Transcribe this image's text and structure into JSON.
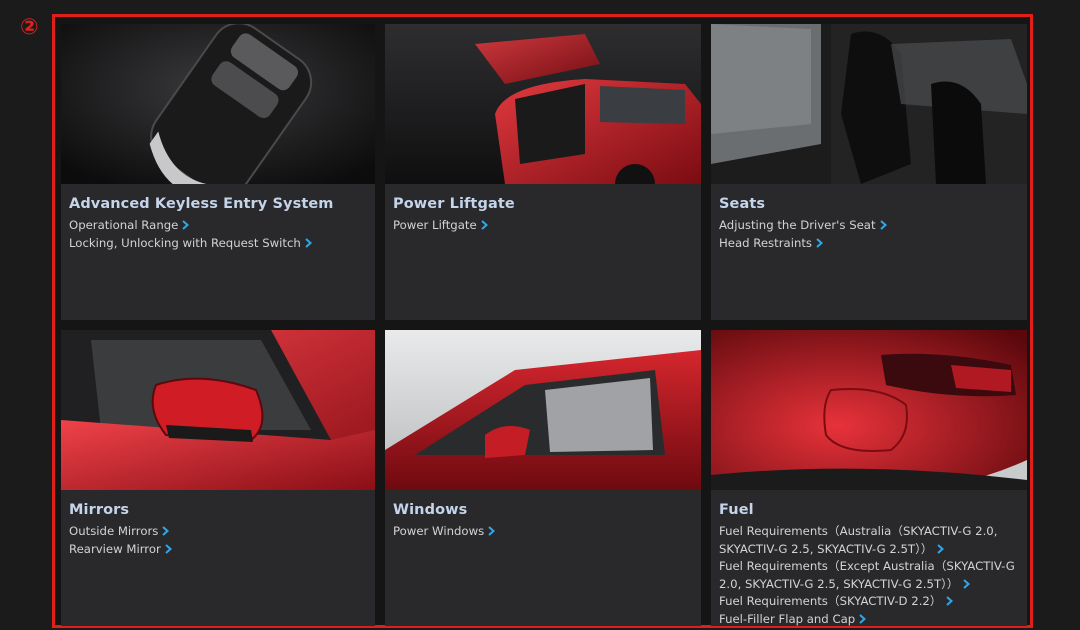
{
  "annotation": {
    "marker": "②"
  },
  "colors": {
    "frame": "#e01f1b",
    "title": "#c4d4ea",
    "link_chevron": "#2ea8ea"
  },
  "cards": [
    {
      "title": "Advanced Keyless Entry System",
      "image": "smart-key-photo",
      "links": [
        "Operational Range",
        "Locking, Unlocking with Request Switch"
      ]
    },
    {
      "title": "Power Liftgate",
      "image": "liftgate-photo",
      "links": [
        "Power Liftgate"
      ]
    },
    {
      "title": "Seats",
      "image": "seats-photo",
      "links": [
        "Adjusting the Driver's Seat",
        "Head Restraints"
      ]
    },
    {
      "title": "Mirrors",
      "image": "mirror-photo",
      "links": [
        "Outside Mirrors",
        "Rearview Mirror"
      ]
    },
    {
      "title": "Windows",
      "image": "windows-photo",
      "links": [
        "Power Windows"
      ]
    },
    {
      "title": "Fuel",
      "image": "fuel-photo",
      "links": [
        "Fuel Requirements（Australia（SKYACTIV-G 2.0, SKYACTIV-G 2.5, SKYACTIV-G 2.5T））",
        "Fuel Requirements（Except Australia（SKYACTIV-G 2.0, SKYACTIV-G 2.5, SKYACTIV-G 2.5T））",
        "Fuel Requirements（SKYACTIV-D 2.2）",
        "Fuel-Filler Flap and Cap"
      ]
    }
  ]
}
